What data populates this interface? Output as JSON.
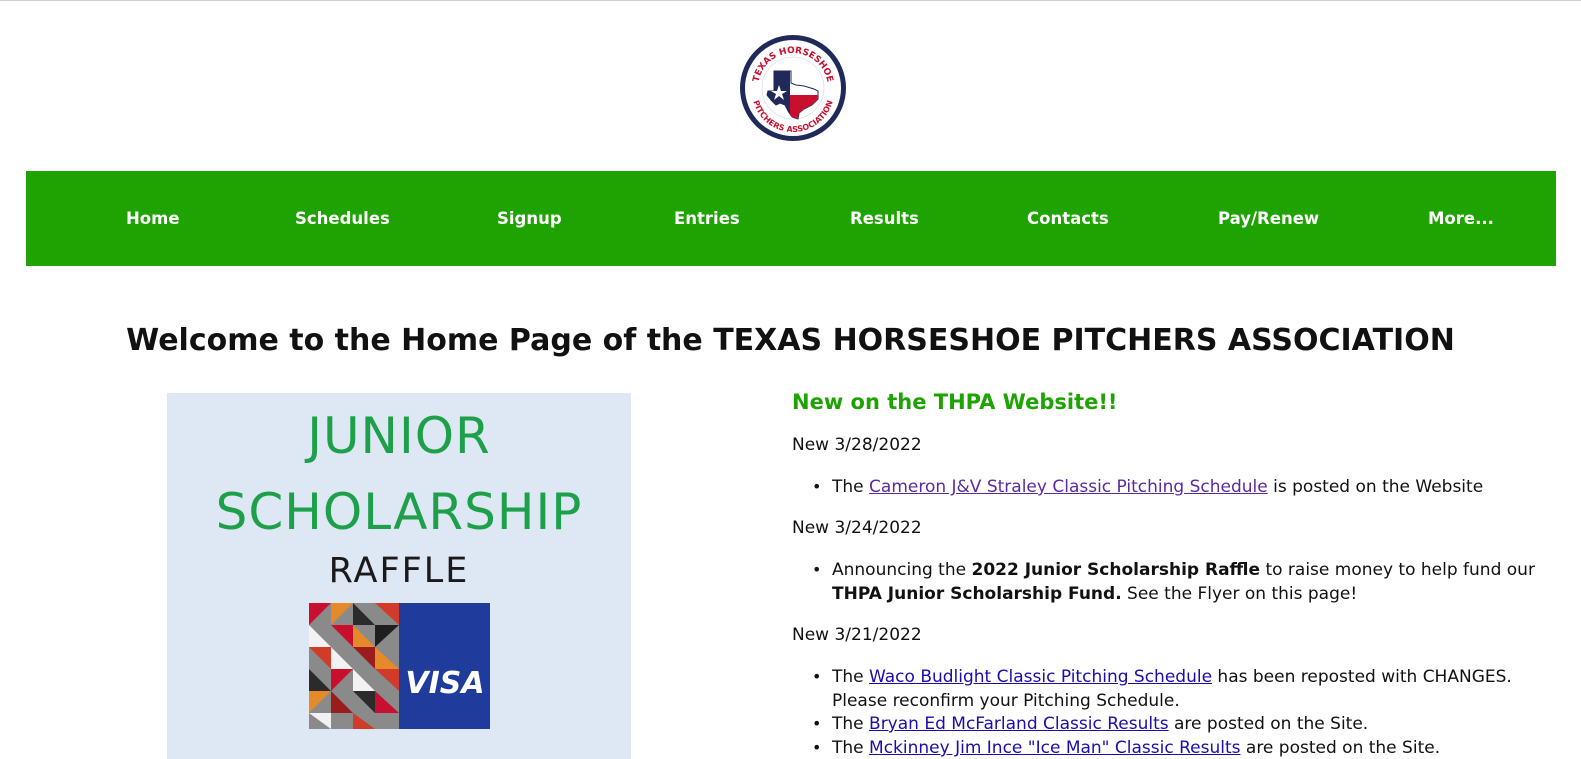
{
  "logo": {
    "text_top": "TEXAS HORSESHOE",
    "text_bottom": "PITCHERS ASSOCIATION",
    "colors": {
      "ring": "#1f2a5a",
      "red": "#c8102e",
      "blue": "#1f2a5a",
      "white": "#ffffff"
    }
  },
  "nav": {
    "items": [
      {
        "label": "Home"
      },
      {
        "label": "Schedules"
      },
      {
        "label": "Signup"
      },
      {
        "label": "Entries"
      },
      {
        "label": "Results"
      },
      {
        "label": "Contacts"
      },
      {
        "label": "Pay/Renew"
      },
      {
        "label": "More..."
      }
    ],
    "background": "#1ea302"
  },
  "welcome": "Welcome to the Home Page of the TEXAS HORSESHOE PITCHERS ASSOCIATION",
  "flyer": {
    "line1": "JUNIOR",
    "line2": "SCHOLARSHIP",
    "line3": "RAFFLE",
    "card_brand": "VISA"
  },
  "news": {
    "title": "New on the THPA Website!!",
    "entries": [
      {
        "date": "New 3/28/2022",
        "bullets": [
          {
            "before": "The ",
            "link": "Cameron J&V Straley Classic Pitching Schedule",
            "after": " is posted on the Website"
          }
        ]
      },
      {
        "date": "New 3/24/2022",
        "bullets": [
          {
            "p1": "Announcing the ",
            "b1": "2022 Junior Scholarship Raffle",
            "p2": " to raise money to help fund our ",
            "b2": "THPA Junior Scholarship Fund.",
            "p3": " See the Flyer on this page!"
          }
        ]
      },
      {
        "date": "New 3/21/2022",
        "bullets": [
          {
            "before": "The ",
            "link": "Waco Budlight Classic Pitching Schedule",
            "after": " has been reposted with CHANGES. Please reconfirm your Pitching Schedule."
          },
          {
            "before": "The ",
            "link": "Bryan Ed McFarland Classic Results",
            "after": " are posted on the Site."
          },
          {
            "before": "The ",
            "link": "Mckinney Jim Ince \"Ice Man\" Classic Results",
            "after": " are posted on the Site."
          }
        ]
      }
    ]
  }
}
